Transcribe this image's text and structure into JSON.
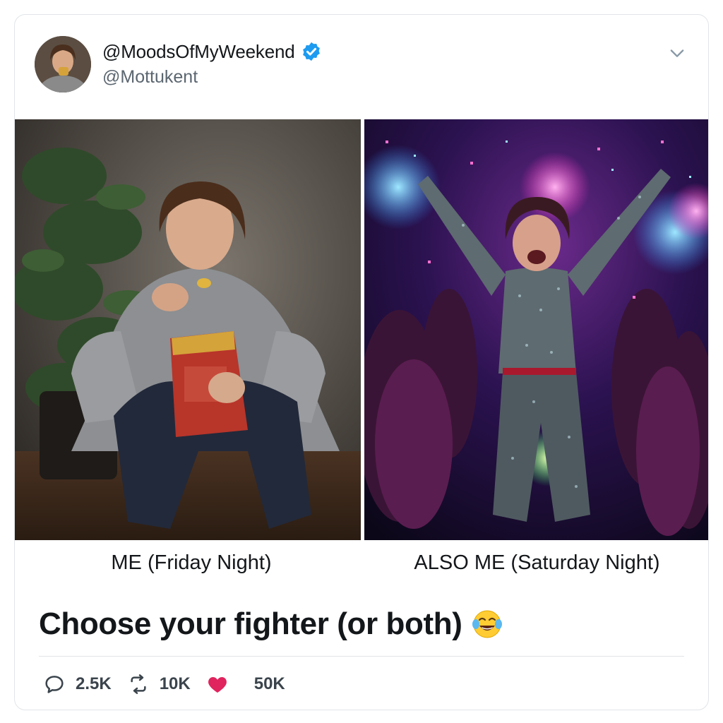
{
  "tweet": {
    "author": {
      "display_name": "@MoodsOfMyWeekend",
      "handle": "@Mottukent",
      "verified": true
    },
    "media": [
      {
        "caption": "ME (Friday Night)",
        "scene": "person-eating-chips-at-home"
      },
      {
        "caption": "ALSO ME (Saturday Night)",
        "scene": "person-dancing-at-party"
      }
    ],
    "text": "Choose your fighter (or both)",
    "emoji": "face-with-tears-of-joy-icon",
    "stats": {
      "replies": "2.5K",
      "retweets": "10K",
      "likes": "50K"
    }
  },
  "icons": [
    "verified-badge-icon",
    "chevron-down-icon",
    "reply-icon",
    "retweet-icon",
    "heart-icon"
  ],
  "colors": {
    "verified_blue": "#1d9bf0",
    "like_red": "#e0245e",
    "text": "#14171a",
    "muted": "#5b6670",
    "border": "#e1e4e8"
  }
}
